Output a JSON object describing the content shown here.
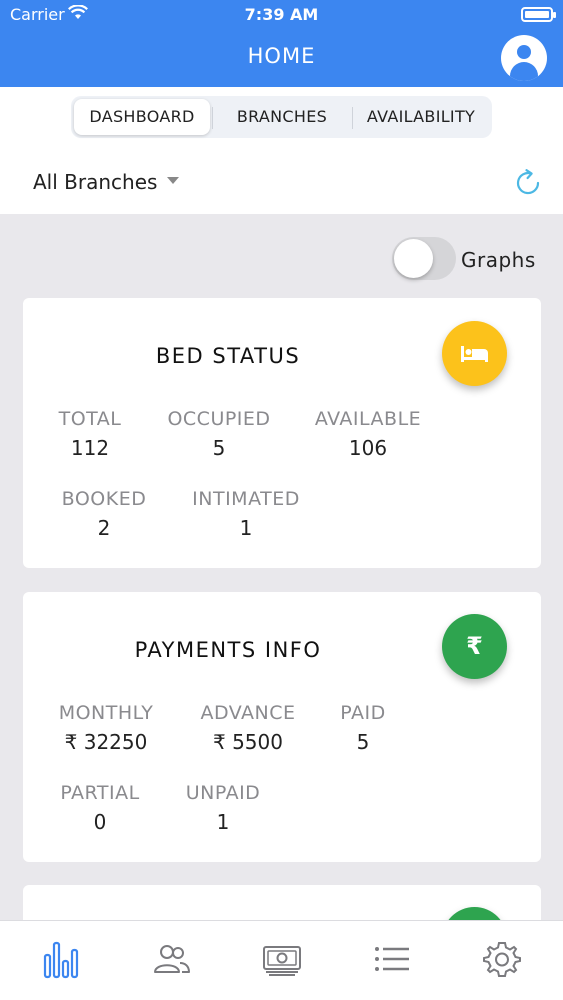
{
  "status_bar": {
    "carrier": "Carrier",
    "time": "7:39 AM"
  },
  "nav": {
    "title": "HOME"
  },
  "segments": [
    {
      "label": "DASHBOARD",
      "active": true
    },
    {
      "label": "BRANCHES",
      "active": false
    },
    {
      "label": "AVAILABILITY",
      "active": false
    }
  ],
  "branch_filter": {
    "value": "All Branches"
  },
  "graphs_toggle": {
    "label": "Graphs",
    "on": false
  },
  "bed_status": {
    "title": "BED STATUS",
    "icon": "bed-icon",
    "color": "#fcc21b",
    "stats": [
      {
        "label": "TOTAL",
        "value": "112"
      },
      {
        "label": "OCCUPIED",
        "value": "5"
      },
      {
        "label": "AVAILABLE",
        "value": "106"
      },
      {
        "label": "BOOKED",
        "value": "2"
      },
      {
        "label": "INTIMATED",
        "value": "1"
      }
    ]
  },
  "payments_info": {
    "title": "PAYMENTS INFO",
    "icon": "rupee-icon",
    "icon_glyph": "₹",
    "color": "#2ea44f",
    "stats": [
      {
        "label": "MONTHLY",
        "value": "₹ 32250"
      },
      {
        "label": "ADVANCE",
        "value": "₹ 5500"
      },
      {
        "label": "PAID",
        "value": "5"
      },
      {
        "label": "PARTIAL",
        "value": "0"
      },
      {
        "label": "UNPAID",
        "value": "1"
      }
    ]
  },
  "next_card": {
    "color": "#2ea44f"
  },
  "tab_bar": {
    "accent": "#3c86f0",
    "inactive": "#7a7a7e",
    "items": [
      {
        "name": "dashboard-tab",
        "icon": "bar-chart-icon",
        "active": true
      },
      {
        "name": "tenants-tab",
        "icon": "users-icon",
        "active": false
      },
      {
        "name": "payments-tab",
        "icon": "cash-icon",
        "active": false
      },
      {
        "name": "list-tab",
        "icon": "list-icon",
        "active": false
      },
      {
        "name": "settings-tab",
        "icon": "gear-icon",
        "active": false
      }
    ]
  }
}
